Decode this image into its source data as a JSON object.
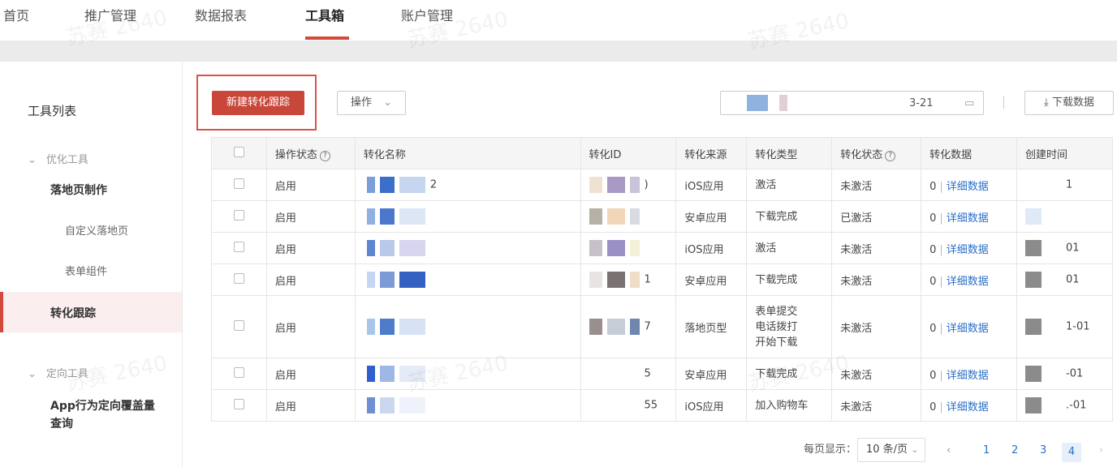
{
  "nav": {
    "home": "首页",
    "promo": "推广管理",
    "reports": "数据报表",
    "toolbox": "工具箱",
    "account": "账户管理"
  },
  "sidebar": {
    "title": "工具列表",
    "group1": "优化工具",
    "landing": "落地页制作",
    "custom_landing": "自定义落地页",
    "form": "表单组件",
    "conversion": "转化跟踪",
    "group2": "定向工具",
    "app_query": "App行为定向覆盖量查询"
  },
  "toolbar": {
    "new_button": "新建转化跟踪",
    "op_button": "操作",
    "date_value": "3-21",
    "download_button": "下载数据"
  },
  "table": {
    "headers": [
      "操作状态",
      "转化名称",
      "转化ID",
      "转化来源",
      "转化类型",
      "转化状态",
      "转化数据",
      "创建时间"
    ],
    "rows": [
      {
        "status": "启用",
        "name": "2",
        "id": ")",
        "source": "iOS应用",
        "type": "激活",
        "conv_status": "未激活",
        "data": "0",
        "link": "详细数据",
        "created": "1"
      },
      {
        "status": "启用",
        "name": "",
        "id": "",
        "source": "安卓应用",
        "type": "下载完成",
        "conv_status": "已激活",
        "data": "0",
        "link": "详细数据",
        "created": ""
      },
      {
        "status": "启用",
        "name": "",
        "id": "",
        "source": "iOS应用",
        "type": "激活",
        "conv_status": "未激活",
        "data": "0",
        "link": "详细数据",
        "created": "01"
      },
      {
        "status": "启用",
        "name": "",
        "id": "1",
        "source": "安卓应用",
        "type": "下载完成",
        "conv_status": "未激活",
        "data": "0",
        "link": "详细数据",
        "created": "01"
      },
      {
        "status": "启用",
        "name": "",
        "id": "7",
        "source": "落地页型",
        "type": "表单提交\n电话拨打\n开始下载",
        "conv_status": "未激活",
        "data": "0",
        "link": "详细数据",
        "created": "1-01"
      },
      {
        "status": "启用",
        "name": "",
        "id": "5",
        "source": "安卓应用",
        "type": "下载完成",
        "conv_status": "未激活",
        "data": "0",
        "link": "详细数据",
        "created": "-01"
      },
      {
        "status": "启用",
        "name": "",
        "id": "55",
        "source": "iOS应用",
        "type": "加入购物车",
        "conv_status": "未激活",
        "data": "0",
        "link": "详细数据",
        "created": ".-01"
      }
    ]
  },
  "pager": {
    "per_page_label": "每页显示：",
    "per_page_value": "10 条/页",
    "pages": [
      "1",
      "2",
      "3"
    ],
    "current": "4"
  },
  "watermark": "苏赛 2640",
  "colors": {
    "accent": "#c9463a",
    "link": "#2b6fc7"
  }
}
